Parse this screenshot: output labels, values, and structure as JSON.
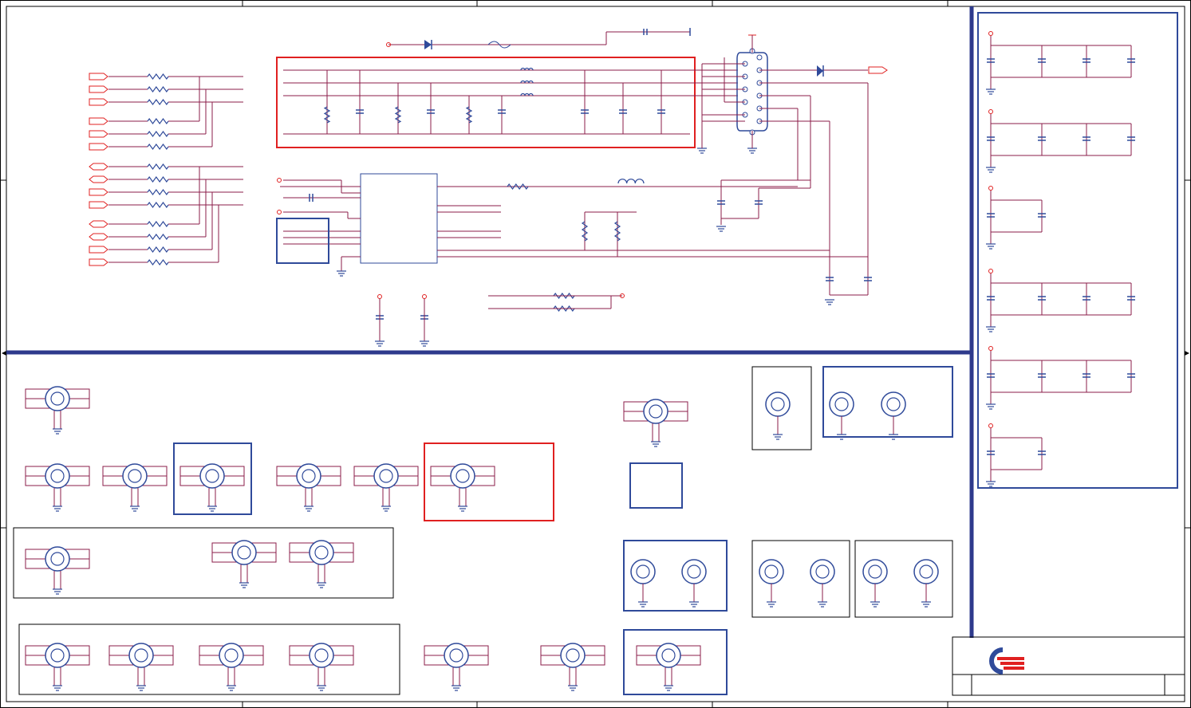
{
  "colors": {
    "border": "#000000",
    "bus": "#2e3a8c",
    "red_box": "#e02020",
    "blue_box": "#2f4a9a",
    "wire": "#8b1c4a",
    "symbol": "#2f4a9a",
    "port": "#e02020"
  },
  "icons": {
    "logo": "company-logo-icon",
    "connector": "vga-connector-icon",
    "mounting_hole": "mounting-hole-icon",
    "ground": "ground-icon"
  },
  "title_block": {
    "logo_alt": "company-logo"
  }
}
